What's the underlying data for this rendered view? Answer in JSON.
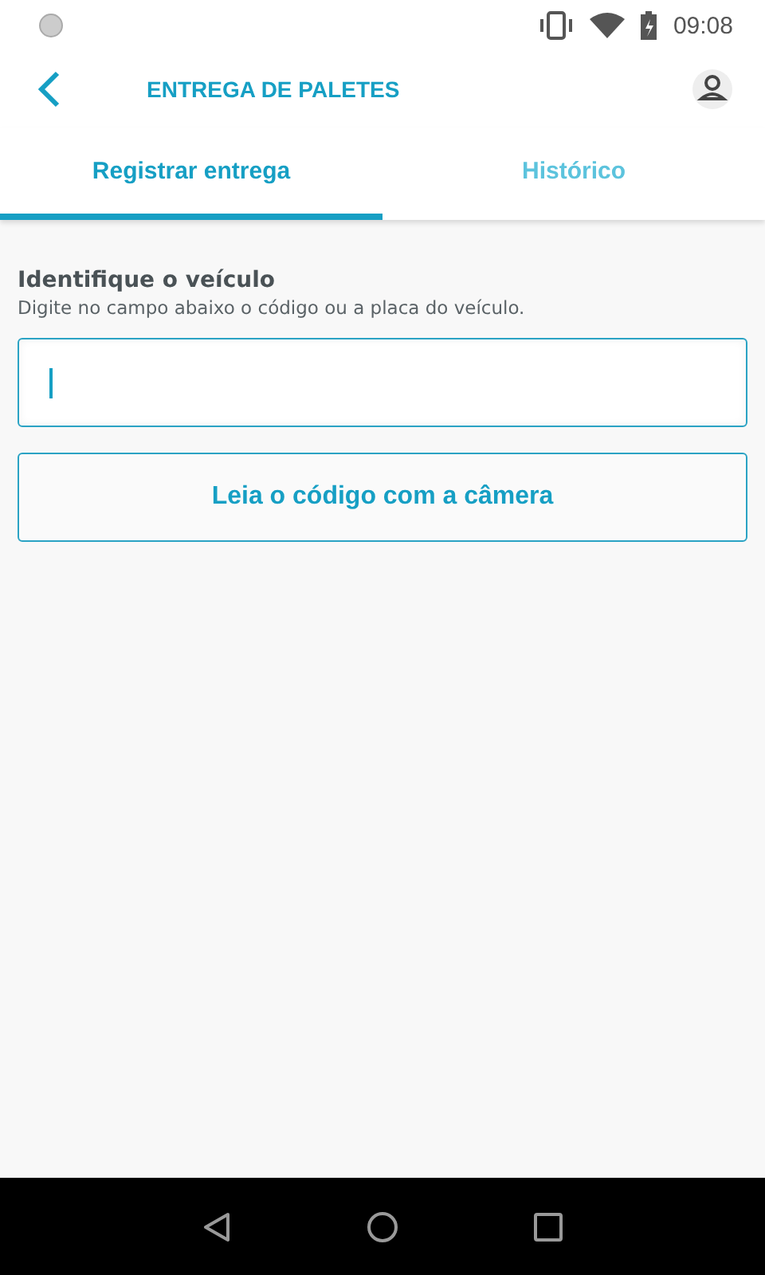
{
  "status_bar": {
    "time": "09:08"
  },
  "header": {
    "title": "ENTREGA DE PALETES"
  },
  "tabs": [
    {
      "label": "Registrar entrega",
      "selected": true
    },
    {
      "label": "Histórico",
      "selected": false
    }
  ],
  "form": {
    "title": "Identifique o veículo",
    "hint": "Digite no campo abaixo o código ou a placa do veículo.",
    "field": {
      "focused": true
    },
    "button": "Leia o código com a câmera"
  }
}
